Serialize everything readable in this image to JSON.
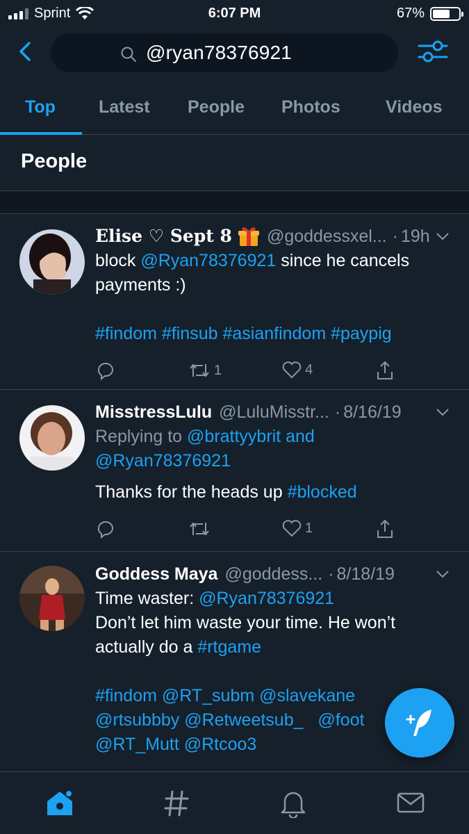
{
  "status_bar": {
    "carrier": "Sprint",
    "time": "6:07 PM",
    "battery": "67%",
    "battery_level": 0.67
  },
  "header": {
    "search_query": "@ryan78376921"
  },
  "tabs": [
    {
      "label": "Top",
      "active": true
    },
    {
      "label": "Latest",
      "active": false
    },
    {
      "label": "People",
      "active": false
    },
    {
      "label": "Photos",
      "active": false
    },
    {
      "label": "Videos",
      "active": false
    }
  ],
  "section": {
    "title": "People"
  },
  "tweets": [
    {
      "name": "Elise ♡ Sept 8",
      "handle": "@goddessxel...",
      "time": "19h",
      "text1": "block ",
      "mention": "@Ryan78376921",
      "text2": " since he cancels payments :)",
      "hashtags": "#findom #finsub #asianfindom #paypig",
      "retweets": "1",
      "likes": "4"
    },
    {
      "name": "MisstressLulu",
      "handle": "@LuluMisstr...",
      "time": "8/16/19",
      "replying_prefix": "Replying to ",
      "reply_to_1": "@brattyybrit",
      "reply_and": " and",
      "reply_to_2": "@Ryan78376921",
      "text1": "Thanks for the heads up ",
      "hashtag": "#blocked",
      "likes": "1"
    },
    {
      "name": "Goddess Maya",
      "handle": "@goddess...",
      "time": "8/18/19",
      "text1": "Time waster: ",
      "mention": "@Ryan78376921",
      "line2": "Don’t let him waste your time. He won’t",
      "line3_prefix": "actually do a ",
      "line3_tag": "#rtgame",
      "tags_line1": "#findom @RT_subm @slavekane",
      "tags_line2": "@rtsubbby @Retweetsub_   @foot",
      "tags_line3": "@RT_Mutt @Rtcoo3"
    }
  ],
  "colors": {
    "background": "#15202b",
    "accent": "#1da1f2",
    "muted": "#8899a6",
    "divider": "#38444d"
  }
}
